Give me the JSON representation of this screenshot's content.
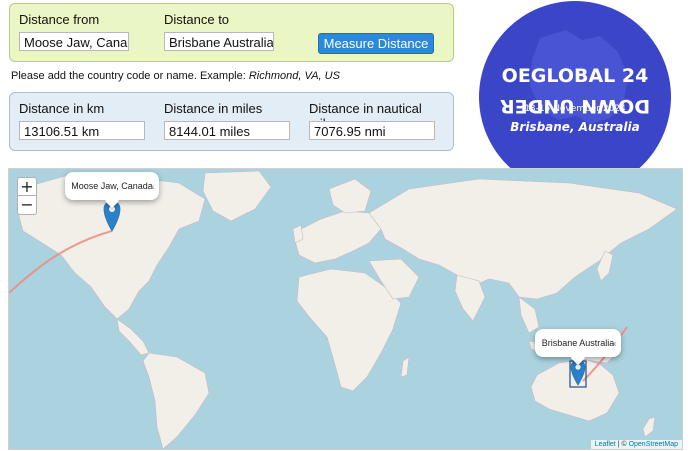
{
  "form": {
    "from_label": "Distance from",
    "to_label": "Distance to",
    "from_value": "Moose Jaw, Canada",
    "to_value": "Brisbane Australia",
    "measure_label": "Measure Distance",
    "hint_prefix": "Please add the country code or name. Example: ",
    "hint_example": "Richmond, VA, US"
  },
  "results": {
    "km_label": "Distance in km",
    "km_value": "13106.51 km",
    "miles_label": "Distance in miles",
    "miles_value": "8144.01 miles",
    "nmi_label": "Distance in nautical miles",
    "nmi_value": "7076.95 nmi"
  },
  "logo": {
    "line1": "OEGLOBAL 24",
    "line2": "DOWN UNDER",
    "dates": "13-15 November 2024",
    "place": "Brisbane, Australia",
    "color": "#3a45c8"
  },
  "map": {
    "zoom_in": "+",
    "zoom_out": "−",
    "popup_a": "Moose Jaw, Canada",
    "popup_b": "Brisbane Australia",
    "close_glyph": "×",
    "attrib_leaflet": "Leaflet",
    "attrib_sep": " | © ",
    "attrib_osm": "OpenStreetMap",
    "route_color": "#f08a80",
    "marker_color": "#2a81cb"
  }
}
